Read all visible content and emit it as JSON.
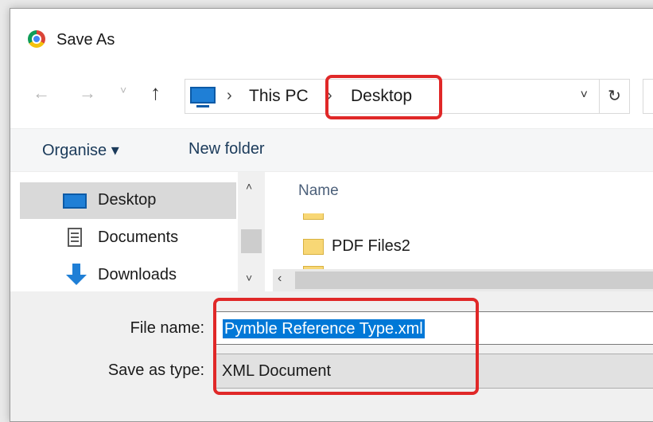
{
  "title": "Save As",
  "nav": {
    "back": "←",
    "forward": "→",
    "recent": "˅",
    "up": "↑"
  },
  "address": {
    "separator": "›",
    "segments": [
      "This PC",
      "Desktop"
    ],
    "dropdown": "˅",
    "refresh": "↻"
  },
  "toolbar": {
    "organise": "Organise ▾",
    "new_folder": "New folder"
  },
  "sidebar": {
    "items": [
      {
        "label": "Desktop",
        "icon": "desktop-icon",
        "selected": true
      },
      {
        "label": "Documents",
        "icon": "documents-icon",
        "selected": false
      },
      {
        "label": "Downloads",
        "icon": "downloads-icon",
        "selected": false
      }
    ],
    "scroll_up": "˄",
    "scroll_down": "˅"
  },
  "files": {
    "column_name": "Name",
    "items": [
      {
        "label": "PDF Files2",
        "icon": "folder-icon"
      }
    ],
    "scroll_left": "‹"
  },
  "form": {
    "file_name_label": "File name:",
    "file_name_value": "Pymble Reference Type.xml",
    "save_as_type_label": "Save as type:",
    "save_as_type_value": "XML Document"
  },
  "colors": {
    "highlight": "#e02828",
    "selection": "#0078d7",
    "accent": "#1f7fd6"
  }
}
